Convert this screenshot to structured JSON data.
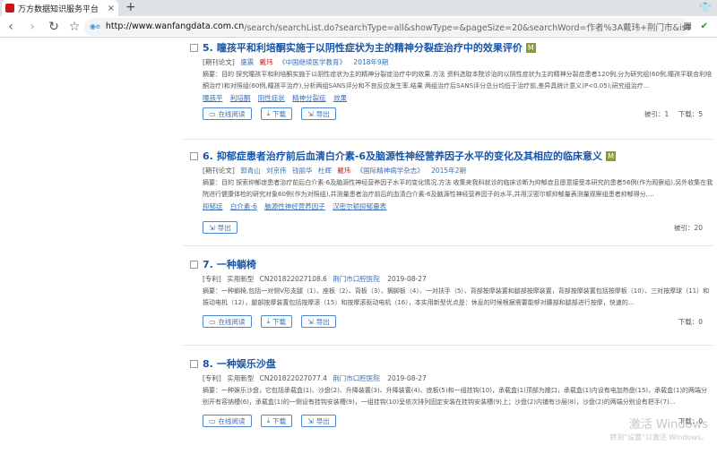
{
  "browser": {
    "tab_title": "万方数据知识服务平台",
    "address_host": "http://www.wanfangdata.com.cn",
    "address_rest": "/search/searchList.do?searchType=all&showType=&pageSize=20&searchWord=作者%3A戴玮+荆门市&isTriggerTag=",
    "new_tab": "+",
    "tab_close": "×"
  },
  "results": [
    {
      "num": "5.",
      "title": "瞳孩平和利培酮实施于以阴性症状为主的精神分裂症治疗中的效果评价",
      "badge": "M",
      "type": "[期刊论文]",
      "authors": [
        "盛震",
        "戴玮"
      ],
      "source": "《中国继续医学教育》",
      "year": "2018年9期",
      "abstract": "摘要：目的 探究瞳孩平和利培酮实施于以阴性症状为主的精神分裂症治疗中的效果.方法 资料选取本院诊治的以阴性症状为主的精神分裂症患者120例,分为研究组(60例,瞳孩平联合利培酮治疗)和对照组(60例,瞳孩平治疗),分析两组SANS评分和不良反应发生率.结果 两组治疗后SANS评分总分均低于治疗前,差异具统计意义(P<0.05);研究组治疗...",
      "keywords": [
        "瞳孩平",
        "利培酮",
        "阴性症状",
        "精神分裂症",
        "效果"
      ],
      "buttons": [
        "在线阅读",
        "下载",
        "导出"
      ],
      "cited": "被引：1",
      "downloads": "下载：5"
    },
    {
      "num": "6.",
      "title": "抑郁症患者治疗前后血清白介素-6及脑源性神经营养因子水平的变化及其相应的临床意义",
      "badge": "M",
      "type": "[期刊论文]",
      "authors": [
        "郭青山",
        "刘京伟",
        "钱丽华",
        "杜辉",
        "戴玮"
      ],
      "source": "《国际精神病学杂志》",
      "year": "2015年2期",
      "abstract": "摘要：目的 探索抑郁症患者治疗前后白介素-6及脑源性神经营养因子水平的变化情况.方法 收集来我科就诊的临床诊断为抑郁症且愿意接受本研究的患者56例(作为观察组),另外收集在我院进行健康体检的研究对象60例(作为对照组),并测量患者治疗前后的血清白介素-6及脑源性神经营养因子的水平,并用汉密尔顿抑郁量表测量观察组患者抑郁得分,...",
      "keywords": [
        "抑郁症",
        "白介素-6",
        "脑源性神经营养因子",
        "汉密尔顿抑郁量表"
      ],
      "buttons": [
        "导出"
      ],
      "cited": "被引：20",
      "downloads": ""
    },
    {
      "num": "7.",
      "title": "一种躺椅",
      "badge": "",
      "type": "[专利]",
      "patent_type": "实用新型",
      "patent_no": "CN201822027108.6",
      "applicant": "荆门市口腔医院",
      "date": "2019-08-27",
      "abstract": "摘要：一种躺椅,包括一对侧V形支腿（1）、座板（2）、背板（3）、搁脚板（4）、一对扶手（5）、背部按摩装置和腿部按摩装置，背部按摩装置包括按摩板（10）、三对按摩球（11）和振动电机（12），腿部按摩装置包括按摩滚（15）和按摩滚驱动电机（16），本实用新型优点是：休息的时候根据需要能够对腰部和腿部进行按摩，快速的...",
      "buttons": [
        "在线阅读",
        "下载",
        "导出"
      ],
      "cited": "",
      "downloads": "下载：0"
    },
    {
      "num": "8.",
      "title": "一种娱乐沙盘",
      "badge": "",
      "type": "[专利]",
      "patent_type": "实用新型",
      "patent_no": "CN201822027077.4",
      "applicant": "荆门市口腔医院",
      "date": "2019-08-27",
      "abstract": "摘要：一种娱乐沙盘，它包括承载盒(1)、沙盘(2)、升降装置(3)、升降装置(4)、底板(5)和一组挂钩(10)，承载盒(1)顶部为敞口，承载盒(1)内设有电加热盘(15)，承载盒(1)的两端分别开有容纳槽(6)，承载盒(1)的一侧设有挂钩安装槽(9)，一组挂钩(10)呈依次排列固定安装在挂钩安装槽(9)上；沙盘(2)内铺有沙层(8)，沙盘(2)的两端分别设有把手(7)...",
      "buttons": [
        "在线阅读",
        "下载",
        "导出"
      ],
      "cited": "",
      "downloads": "下载：0"
    }
  ],
  "watermark": {
    "line1": "激活 Windows",
    "line2": "转到\"设置\"以激活 Windows。"
  }
}
